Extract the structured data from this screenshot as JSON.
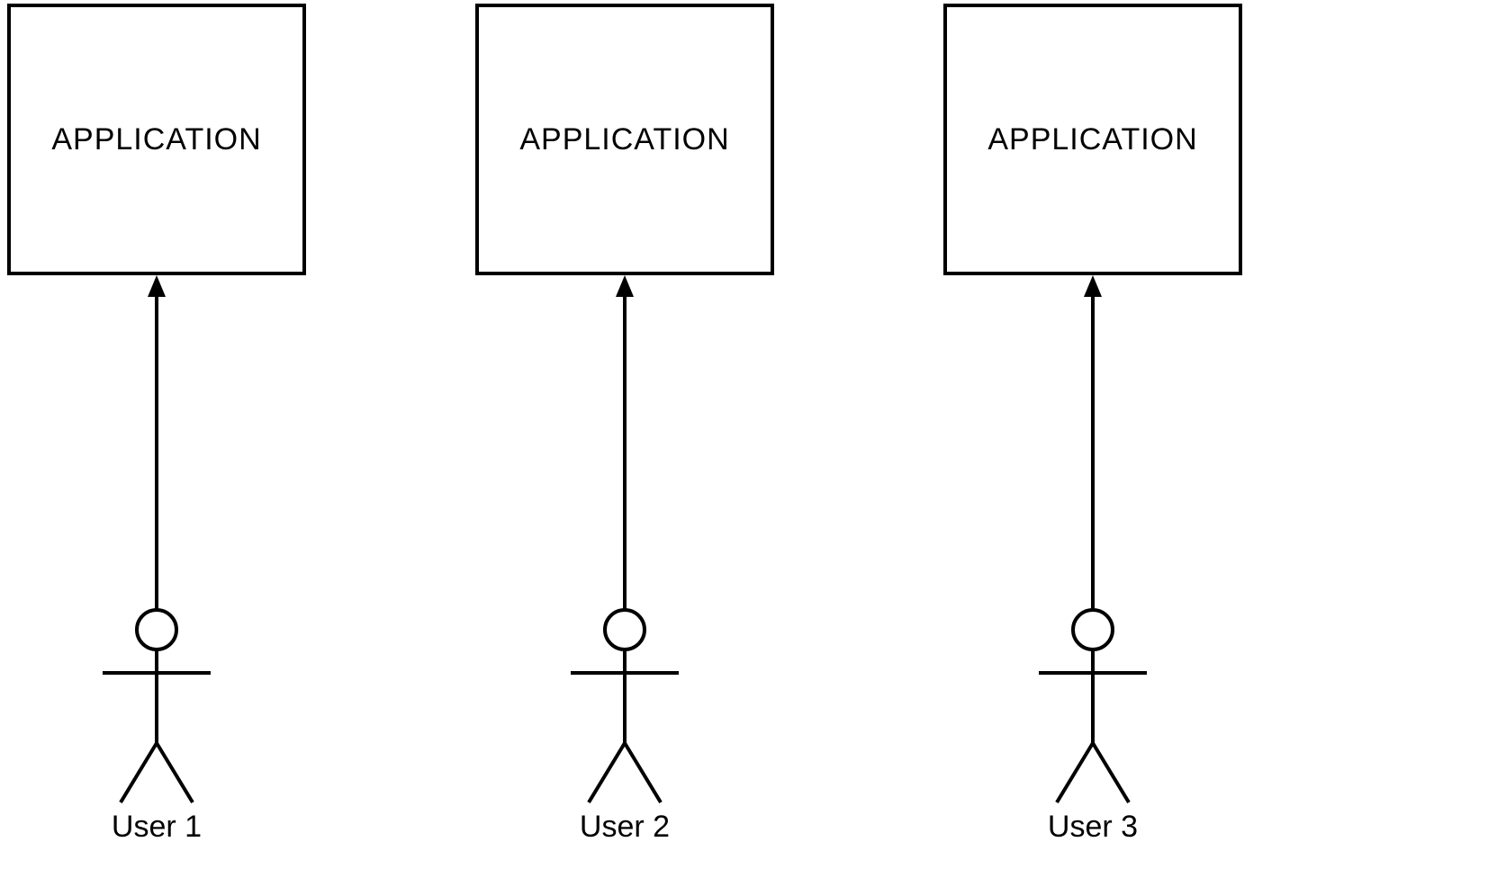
{
  "diagram": {
    "columns": [
      {
        "app_label": "APPLICATION",
        "user_label": "User 1"
      },
      {
        "app_label": "APPLICATION",
        "user_label": "User 2"
      },
      {
        "app_label": "APPLICATION",
        "user_label": "User 3"
      }
    ]
  }
}
